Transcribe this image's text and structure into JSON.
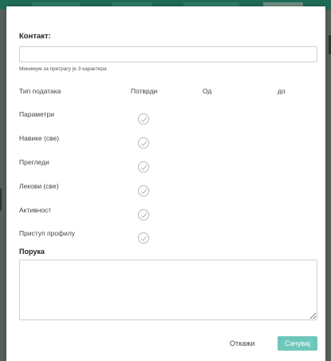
{
  "dialog": {
    "contact_label": "Контакт:",
    "contact_value": "",
    "contact_placeholder": "",
    "hint": "Минимум за претрагу је 3 карактера",
    "columns": {
      "type": "Тип података",
      "confirm": "Потврди",
      "from": "Од",
      "to": "до"
    },
    "rows": [
      {
        "label": "Параметри",
        "confirmed": false
      },
      {
        "label": "Навике (све)",
        "confirmed": false
      },
      {
        "label": "Прегледи",
        "confirmed": false
      },
      {
        "label": "Лекови (све)",
        "confirmed": false
      },
      {
        "label": "Активност",
        "confirmed": false
      },
      {
        "label": "Приступ профилу",
        "confirmed": false
      }
    ],
    "note_label": "Порука",
    "note_value": "",
    "cancel_label": "Откажи",
    "save_label": "Сачувај"
  },
  "colors": {
    "accent": "#6dc7bb",
    "header_bar": "#1f6b57",
    "backdrop": "#3d4a44"
  }
}
